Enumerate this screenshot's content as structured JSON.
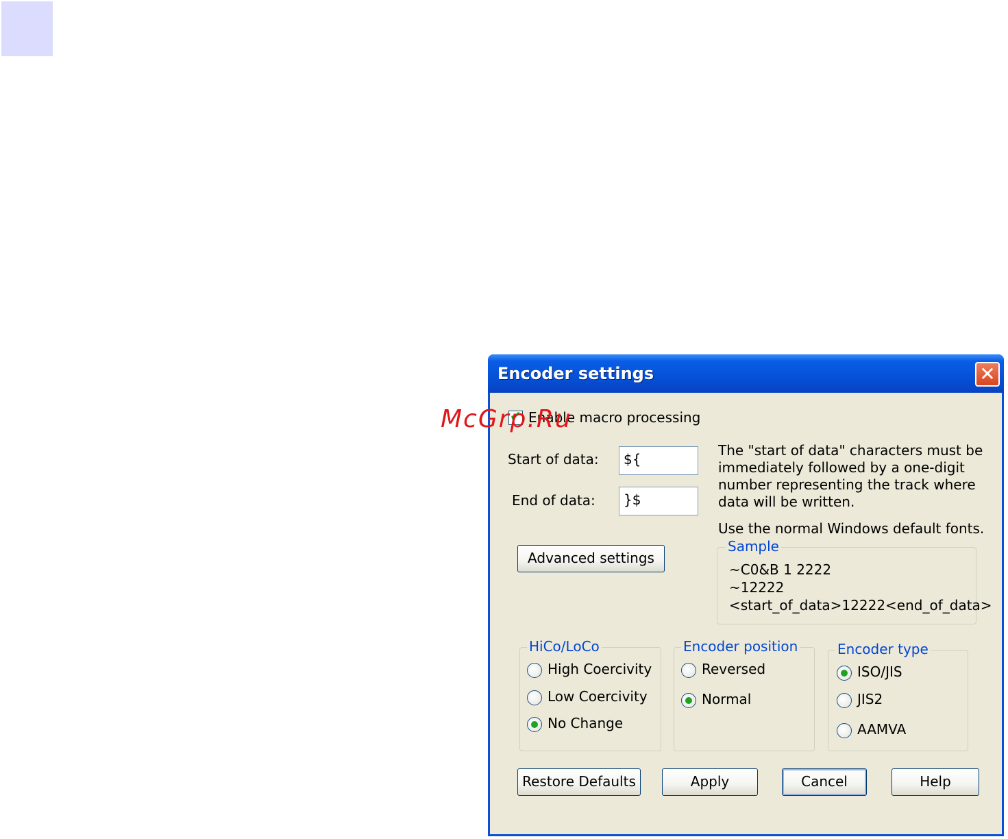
{
  "dialog": {
    "title": "Encoder settings",
    "close_glyph": "✕"
  },
  "watermark": "McGrp.Ru",
  "macro": {
    "checkbox_label": "Enable macro processing",
    "checked": true
  },
  "fields": {
    "start_label": "Start of data:",
    "start_value": "${",
    "end_label": "End of data:",
    "end_value": "}$"
  },
  "help_text": {
    "line1": "The \"start of data\" characters must be",
    "line2": "immediately followed by a one-digit",
    "line3": "number representing the track where",
    "line4": "data will be written.",
    "fonts_note": "Use the normal Windows default fonts."
  },
  "buttons": {
    "advanced": "Advanced settings",
    "restore": "Restore Defaults",
    "apply": "Apply",
    "cancel": "Cancel",
    "help": "Help"
  },
  "sample": {
    "title": "Sample",
    "lines": [
      "~C0&B 1 2222",
      "~12222",
      "<start_of_data>12222<end_of_data>"
    ]
  },
  "hico_loco": {
    "title": "HiCo/LoCo",
    "options": [
      "High Coercivity",
      "Low Coercivity",
      "No Change"
    ],
    "selected": "No Change"
  },
  "encoder_position": {
    "title": "Encoder position",
    "options": [
      "Reversed",
      "Normal"
    ],
    "selected": "Normal"
  },
  "encoder_type": {
    "title": "Encoder type",
    "options": [
      "ISO/JIS",
      "JIS2",
      "AAMVA"
    ],
    "selected": "ISO/JIS"
  }
}
